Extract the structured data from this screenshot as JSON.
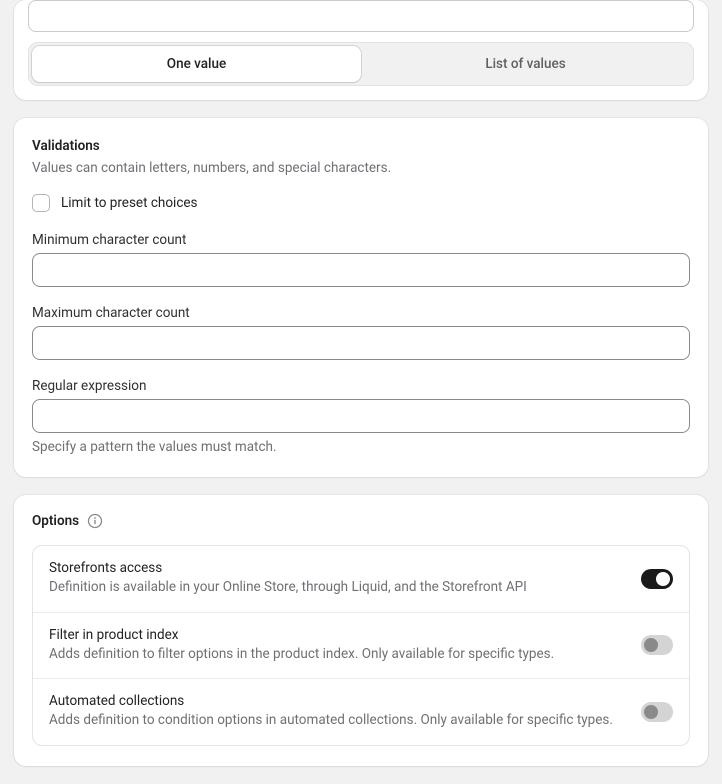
{
  "segmented": {
    "one_value": "One value",
    "list_of_values": "List of values"
  },
  "validations": {
    "title": "Validations",
    "description": "Values can contain letters, numbers, and special characters.",
    "limit_checkbox_label": "Limit to preset choices",
    "min_label": "Minimum character count",
    "min_value": "",
    "max_label": "Maximum character count",
    "max_value": "",
    "regex_label": "Regular expression",
    "regex_value": "",
    "regex_help": "Specify a pattern the values must match."
  },
  "options": {
    "title": "Options",
    "items": [
      {
        "title": "Storefronts access",
        "description": "Definition is available in your Online Store, through Liquid, and the Storefront API",
        "on": true
      },
      {
        "title": "Filter in product index",
        "description": "Adds definition to filter options in the product index. Only available for specific types.",
        "on": false
      },
      {
        "title": "Automated collections",
        "description": "Adds definition to condition options in automated collections. Only available for specific types.",
        "on": false
      }
    ]
  }
}
